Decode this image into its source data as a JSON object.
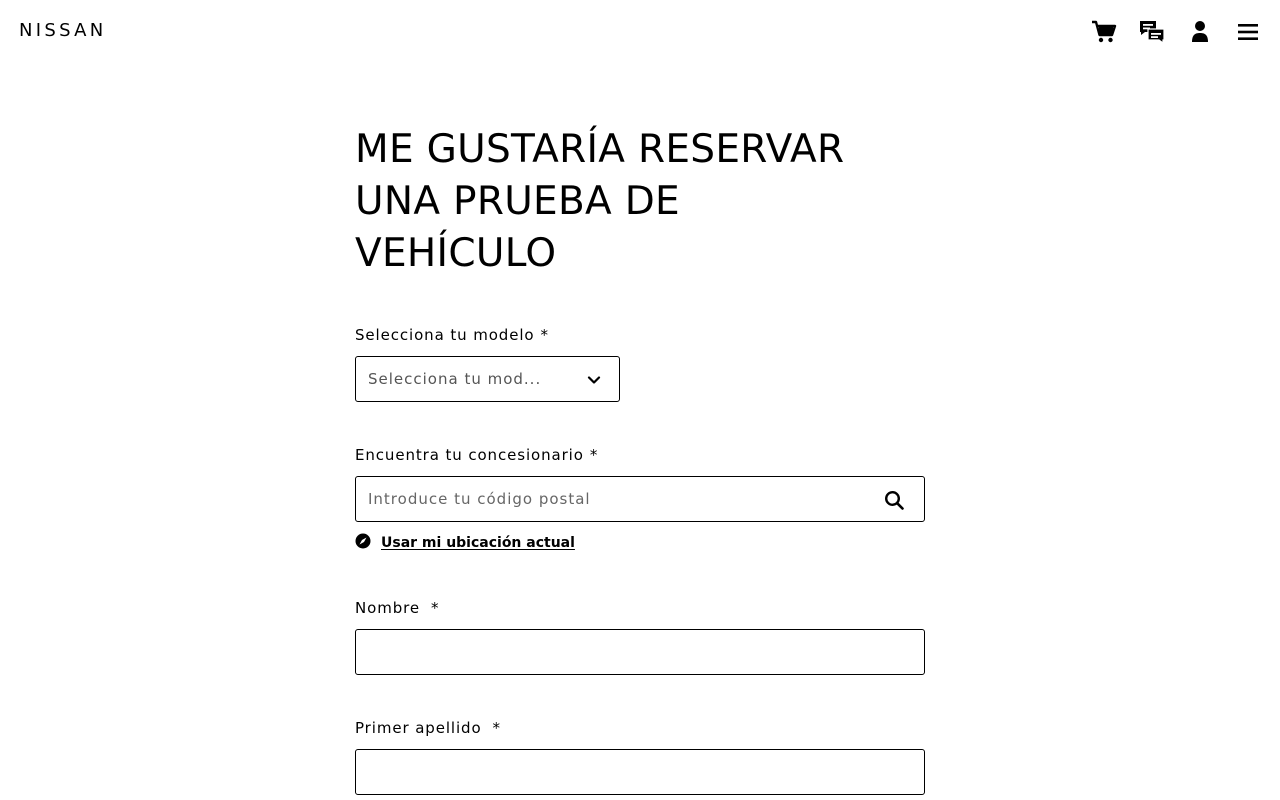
{
  "header": {
    "logo": "NISSAN",
    "icons": [
      "cart-icon",
      "chat-icon",
      "account-icon",
      "menu-icon"
    ]
  },
  "main": {
    "title_lines": [
      "ME GUSTARÍA RESERVAR",
      "UNA PRUEBA DE",
      "VEHÍCULO"
    ],
    "model": {
      "label": "Selecciona tu modelo",
      "required_mark": "*",
      "placeholder": "Selecciona tu mod..."
    },
    "dealer": {
      "label": "Encuentra tu concesionario",
      "required_mark": "*",
      "placeholder": "Introduce tu código postal",
      "location_link": "Usar mi ubicación actual"
    },
    "first_name": {
      "label": "Nombre",
      "required_mark": "*",
      "value": ""
    },
    "last_name": {
      "label": "Primer apellido",
      "required_mark": "*",
      "value": ""
    }
  },
  "colors": {
    "text": "#000000",
    "background": "#ffffff",
    "placeholder": "#666666"
  }
}
